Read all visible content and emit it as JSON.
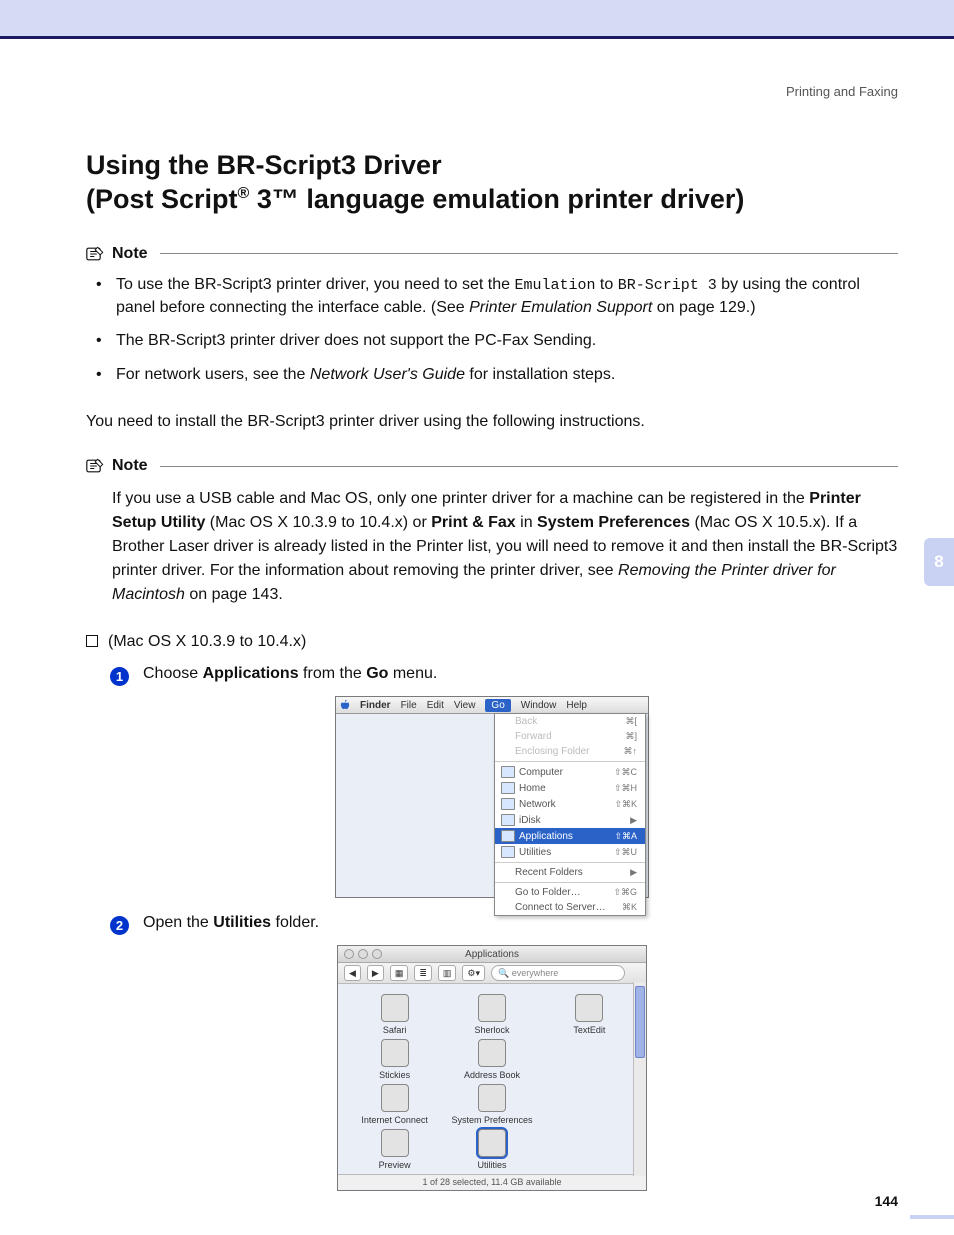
{
  "header": {
    "section": "Printing and Faxing"
  },
  "title": {
    "line1": "Using the BR-Script3 Driver",
    "line2_a": "(Post Script",
    "reg": "®",
    "line2_b": " 3™ language emulation printer driver)"
  },
  "note1": {
    "label": "Note",
    "b1_a": "To use the BR-Script3 printer driver, you need to set the ",
    "b1_code1": "Emulation",
    "b1_b": " to ",
    "b1_code2": "BR-Script 3",
    "b1_c": " by using the control panel before connecting the interface cable. (See ",
    "b1_i": "Printer Emulation Support",
    "b1_d": " on page 129.)",
    "b2": "The BR-Script3 printer driver does not support the PC-Fax Sending.",
    "b3_a": "For network users, see the ",
    "b3_i": "Network User's Guide",
    "b3_b": " for installation steps."
  },
  "intro": "You need to install the BR-Script3 printer driver using the following instructions.",
  "note2": {
    "label": "Note",
    "a": "If you use a USB cable and Mac OS, only one printer driver for a machine can be registered in the ",
    "b": "Printer Setup Utility",
    "c": " (Mac OS X 10.3.9 to 10.4.x) or ",
    "d": "Print & Fax",
    "e": " in ",
    "f": "System Preferences",
    "g": " (Mac OS X 10.5.x). If a Brother Laser driver is already listed in the Printer list, you will need to remove it and then install the BR-Script3 printer driver. For the information about removing the printer driver, see ",
    "h": "Removing the Printer driver for Macintosh",
    "i": " on page 143."
  },
  "subsection": "(Mac OS X 10.3.9 to 10.4.x)",
  "step1": {
    "num": "1",
    "a": "Choose ",
    "b": "Applications",
    "c": " from the ",
    "d": "Go",
    "e": " menu."
  },
  "step2": {
    "num": "2",
    "a": "Open the ",
    "b": "Utilities",
    "c": " folder."
  },
  "menubar": {
    "items": [
      "Finder",
      "File",
      "Edit",
      "View",
      "Go",
      "Window",
      "Help"
    ]
  },
  "gomenu": {
    "disabled": [
      {
        "label": "Back",
        "sc": "⌘["
      },
      {
        "label": "Forward",
        "sc": "⌘]"
      },
      {
        "label": "Enclosing Folder",
        "sc": "⌘↑"
      }
    ],
    "places": [
      {
        "label": "Computer",
        "sc": "⇧⌘C"
      },
      {
        "label": "Home",
        "sc": "⇧⌘H"
      },
      {
        "label": "Network",
        "sc": "⇧⌘K"
      },
      {
        "label": "iDisk",
        "sc": "▶"
      }
    ],
    "hilite": {
      "label": "Applications",
      "sc": "⇧⌘A"
    },
    "after": [
      {
        "label": "Utilities",
        "sc": "⇧⌘U"
      }
    ],
    "recent": {
      "label": "Recent Folders",
      "sc": "▶"
    },
    "tail": [
      {
        "label": "Go to Folder…",
        "sc": "⇧⌘G"
      },
      {
        "label": "Connect to Server…",
        "sc": "⌘K"
      }
    ]
  },
  "appsWindow": {
    "title": "Applications",
    "search": "everywhere",
    "nav_back": "◀",
    "nav_fwd": "▶",
    "view_icons": "▦",
    "view_list": "≣",
    "view_col": "▥",
    "gear": "⚙︎▾",
    "apps": [
      "Safari",
      "Sherlock",
      "TextEdit",
      "Stickies",
      "Address Book",
      "",
      "Internet Connect",
      "System Preferences",
      "",
      "Preview",
      "Utilities",
      ""
    ],
    "selectedIndex": 10,
    "status": "1 of 28 selected, 11.4 GB available"
  },
  "chapterTab": "8",
  "pageNumber": "144"
}
